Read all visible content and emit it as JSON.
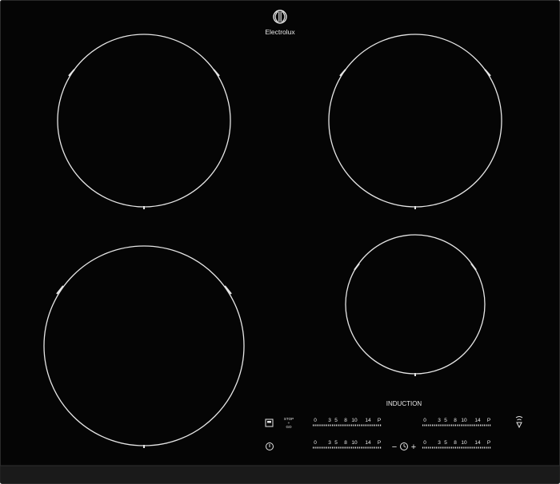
{
  "brand": {
    "name": "Electrolux",
    "logo_icon": "electrolux-logo-icon"
  },
  "induction_label": "INDUCTION",
  "zones": [
    {
      "id": "rear-left"
    },
    {
      "id": "rear-right"
    },
    {
      "id": "front-left"
    },
    {
      "id": "front-right"
    }
  ],
  "controls": {
    "timer_icon": "timer-box-icon",
    "stop_go": {
      "top": "STOP",
      "middle": "+",
      "bottom": "GO"
    },
    "power_icon": "power-icon",
    "bridge_icon": "hob-to-hood-icon",
    "timer_clock_icon": "clock-icon",
    "timer_minus": "−",
    "timer_plus": "+",
    "sliders": [
      {
        "id": "slider-top-left",
        "ticks": [
          "0",
          "3",
          "5",
          "8",
          "10",
          "14",
          "P"
        ]
      },
      {
        "id": "slider-top-right",
        "ticks": [
          "0",
          "3",
          "5",
          "8",
          "10",
          "14",
          "P"
        ]
      },
      {
        "id": "slider-bottom-left",
        "ticks": [
          "0",
          "3",
          "5",
          "8",
          "10",
          "14",
          "P"
        ]
      },
      {
        "id": "slider-bottom-right",
        "ticks": [
          "0",
          "3",
          "5",
          "8",
          "10",
          "14",
          "P"
        ]
      }
    ]
  },
  "colors": {
    "glass": "#050505",
    "frame": "#1c1c1c",
    "line": "#e6e6e6"
  }
}
